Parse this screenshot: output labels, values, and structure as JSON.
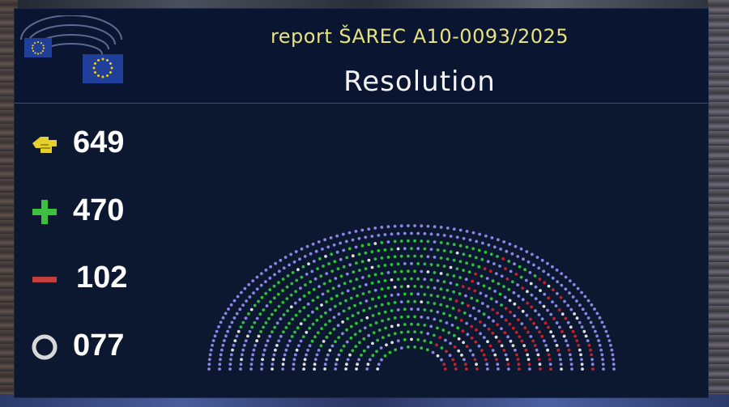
{
  "header": {
    "report_title": "report ŠAREC A10-0093/2025",
    "vote_subject": "Resolution"
  },
  "tallies": [
    {
      "name": "votes-cast",
      "value": "649",
      "icon": "voting-hand-icon",
      "color": "#e5d12a"
    },
    {
      "name": "in-favour",
      "value": "470",
      "icon": "plus-icon",
      "color": "#3fbf3f"
    },
    {
      "name": "against",
      "value": "102",
      "icon": "minus-icon",
      "color": "#c44040"
    },
    {
      "name": "abstentions",
      "value": "077",
      "icon": "circle-icon",
      "color": "#d8d8d8"
    }
  ],
  "colors": {
    "in_favour": "#2fbf3a",
    "against": "#c8202a",
    "abstention": "#e0e0e0",
    "did_not_vote": "#8a86e6",
    "eu_blue": "#1f3f9a",
    "eu_gold": "#f0d000"
  }
}
